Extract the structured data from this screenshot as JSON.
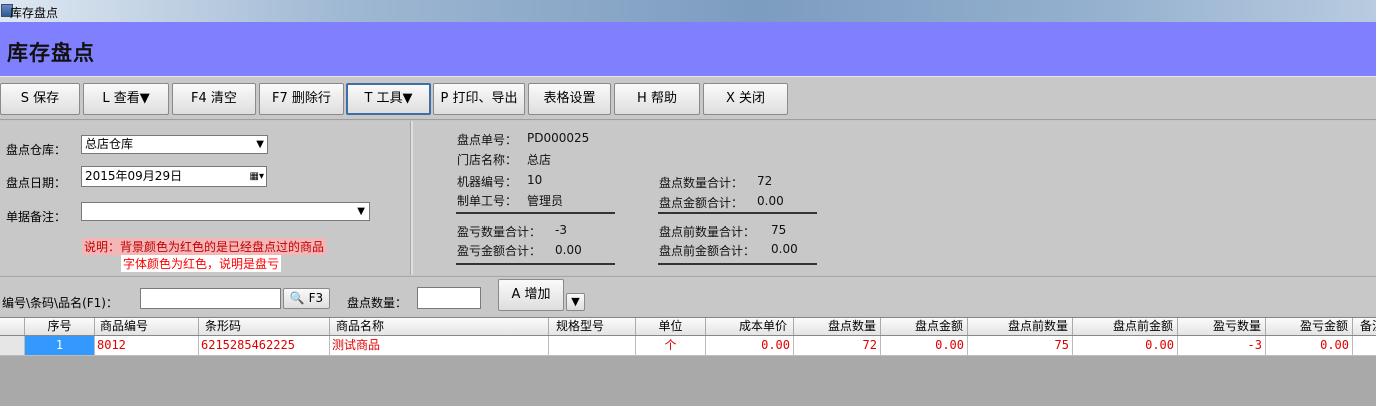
{
  "window": {
    "title": "库存盘点"
  },
  "header": {
    "title": "库存盘点"
  },
  "toolbar": {
    "buttons": [
      {
        "label": "S 保存"
      },
      {
        "label": "L 查看▼"
      },
      {
        "label": "F4 清空"
      },
      {
        "label": "F7 删除行"
      },
      {
        "label": "T 工具▼"
      },
      {
        "label": "P 打印、导出"
      },
      {
        "label": "表格设置"
      },
      {
        "label": "H 帮助"
      },
      {
        "label": "X 关闭"
      }
    ]
  },
  "form": {
    "warehouse_label": "盘点仓库：",
    "warehouse_value": "总店仓库",
    "date_label": "盘点日期：",
    "date_value": "2015年09月29日",
    "remark_label": "单据备注：",
    "remark_value": "",
    "note_line1": "说明：背景颜色为红色的是已经盘点过的商品",
    "note_line2": "字体颜色为红色，说明是盘亏"
  },
  "info": {
    "order_no_label": "盘点单号：",
    "order_no": "PD000025",
    "store_label": "门店名称：",
    "store": "总店",
    "machine_label": "机器编号：",
    "machine": "10",
    "operator_label": "制单工号：",
    "operator": "管理员",
    "qty_total_label": "盘点数量合计：",
    "qty_total": "72",
    "amount_total_label": "盘点金额合计：",
    "amount_total": "0.00",
    "diff_qty_label": "盈亏数量合计：",
    "diff_qty": "-3",
    "diff_amount_label": "盈亏金额合计：",
    "diff_amount": "0.00",
    "before_qty_label": "盘点前数量合计：",
    "before_qty": "75",
    "before_amount_label": "盘点前金额合计：",
    "before_amount": "0.00"
  },
  "search": {
    "label": "编号\\条码\\品名(F1)：",
    "value": "",
    "button_label": "F3",
    "qty_label": "盘点数量：",
    "qty_value": "",
    "add_label": "A 增加"
  },
  "grid": {
    "columns": [
      "序号",
      "商品编号",
      "条形码",
      "商品名称",
      "规格型号",
      "单位",
      "成本单价",
      "盘点数量",
      "盘点金额",
      "盘点前数量",
      "盘点前金额",
      "盈亏数量",
      "盈亏金额",
      "备注"
    ],
    "rows": [
      [
        "1",
        "8012",
        "6215285462225",
        "测试商品",
        "",
        "个",
        "0.00",
        "72",
        "0.00",
        "75",
        "0.00",
        "-3",
        "0.00",
        ""
      ]
    ]
  },
  "colors": {
    "header_bg": "#8080ff",
    "selection": "#3399ff",
    "loss_text": "#e00000",
    "note_bg": "#f4b6b6"
  }
}
